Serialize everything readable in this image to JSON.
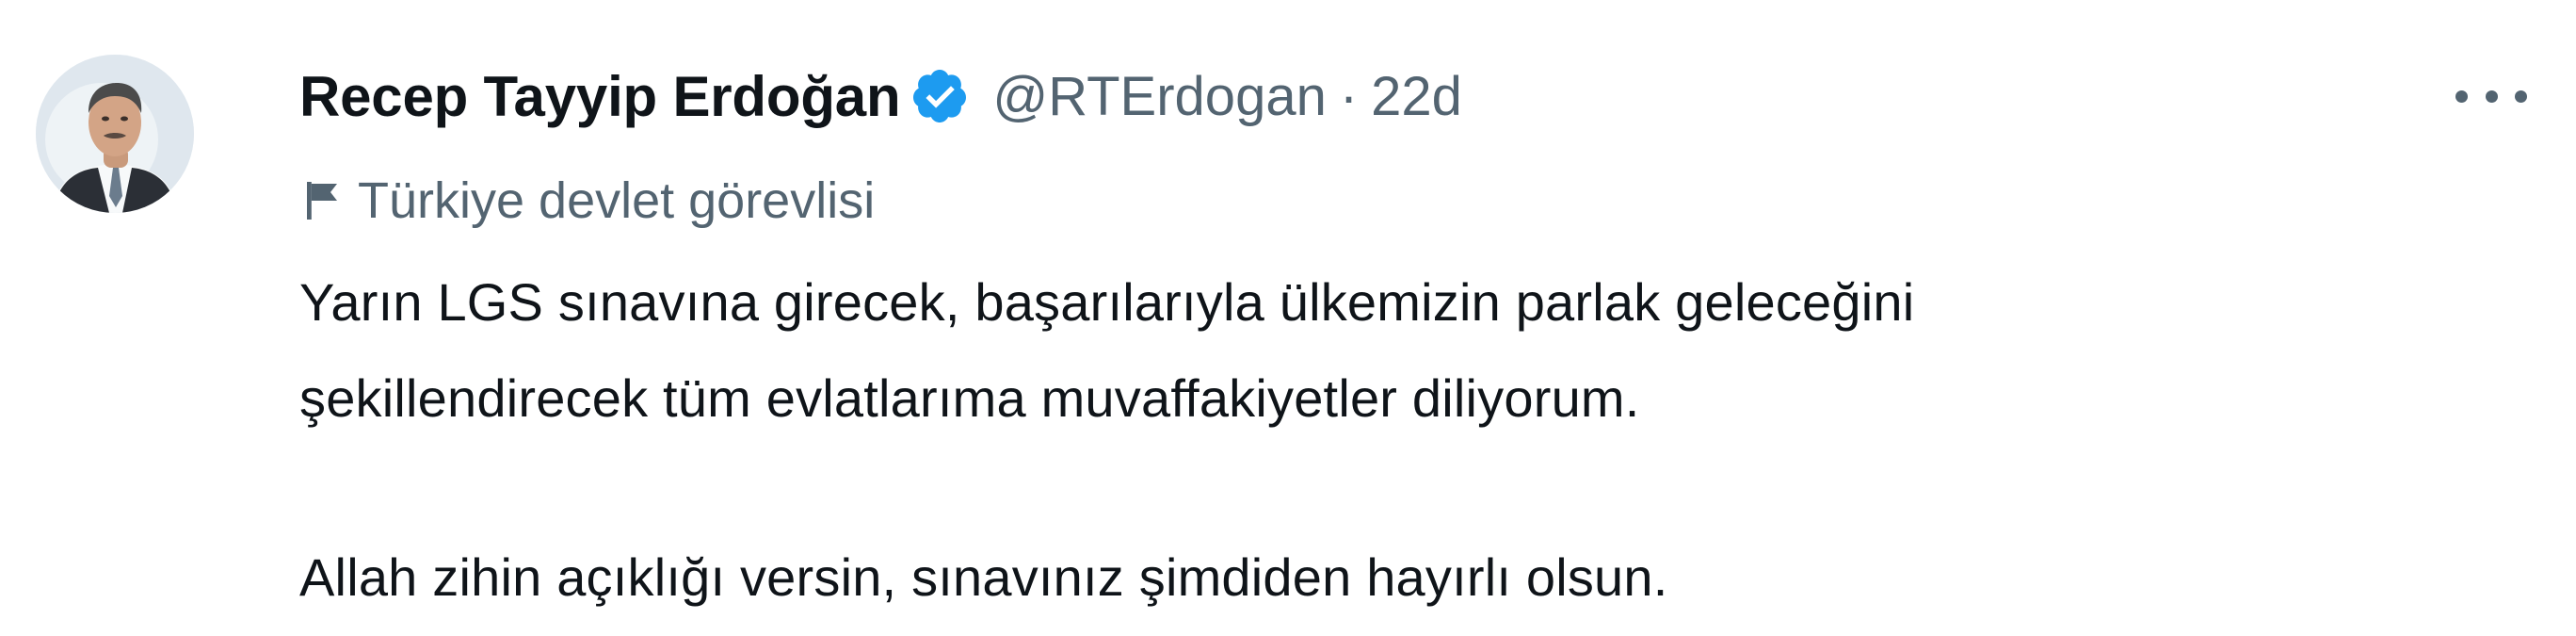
{
  "tweet": {
    "author": {
      "display_name": "Recep Tayyip Erdoğan",
      "handle": "@RTErdogan",
      "verified_icon": "verified-badge-icon",
      "avatar": "profile-photo"
    },
    "separator": "·",
    "timestamp": "22d",
    "more_icon": "more-dots-icon",
    "label": {
      "icon": "flag-icon",
      "text": "Türkiye devlet görevlisi"
    },
    "text_lines": [
      "Yarın LGS sınavına girecek, başarılarıyla ülkemizin parlak geleceğini",
      "şekillendirecek tüm evlatlarıma muvaffakiyetler diliyorum.",
      "Allah zihin açıklığı versin, sınavınız şimdiden hayırlı olsun."
    ]
  },
  "colors": {
    "text_primary": "#0f1419",
    "text_secondary": "#536471",
    "verified_blue": "#1d9bf0",
    "background": "#ffffff"
  }
}
